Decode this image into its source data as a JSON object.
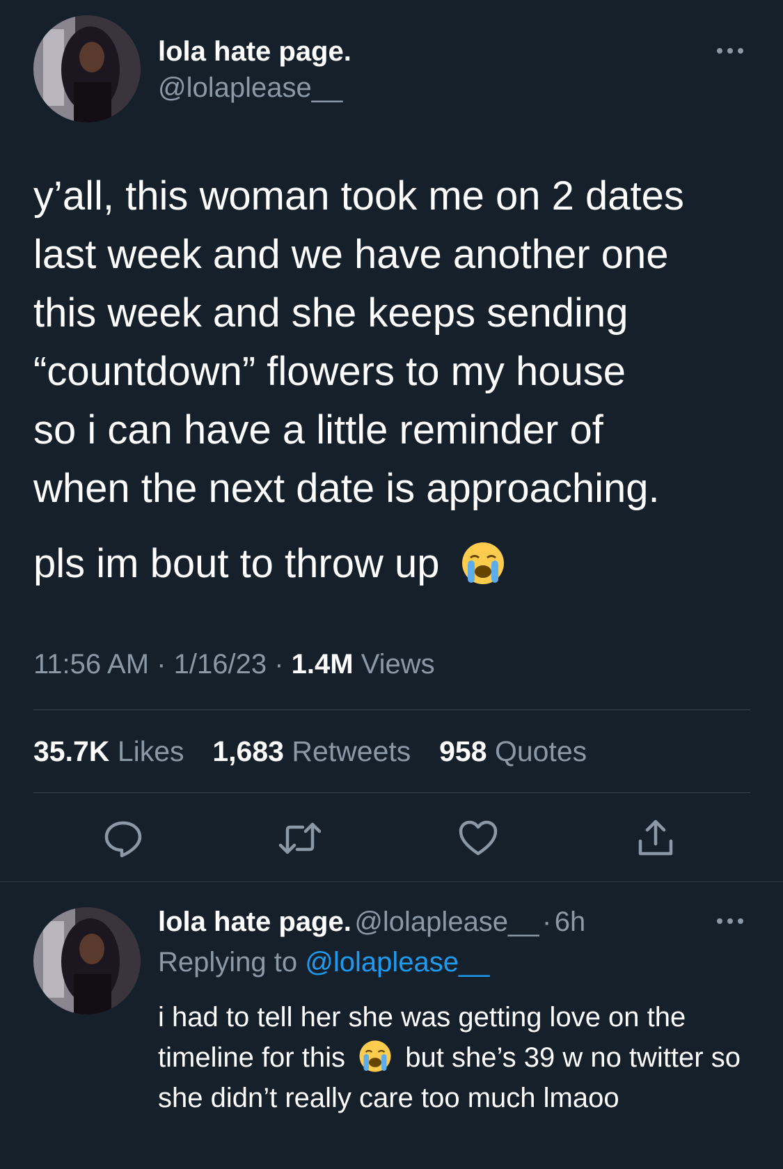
{
  "tweet": {
    "display_name": "lola hate page.",
    "handle": "@lolaplease__",
    "text_lines": [
      "y’all, this woman took me on 2 dates",
      "last week and we have another one",
      "this week and she keeps sending",
      "“countdown” flowers to my house",
      "so i can have a little reminder of",
      "when the next date is approaching."
    ],
    "text_second": "pls im bout to throw up",
    "emoji": "loudly-crying-face",
    "time": "11:56 AM",
    "date": "1/16/23",
    "views_count": "1.4M",
    "views_label": "Views",
    "likes_count": "35.7K",
    "likes_label": "Likes",
    "retweets_count": "1,683",
    "retweets_label": "Retweets",
    "quotes_count": "958",
    "quotes_label": "Quotes",
    "actions": [
      "reply-icon",
      "retweet-icon",
      "like-icon",
      "share-icon"
    ]
  },
  "reply": {
    "display_name": "lola hate page.",
    "handle": "@lolaplease__",
    "age": "6h",
    "replying_prefix": "Replying to",
    "replying_handle": "@lolaplease__",
    "text_part1": "i had to tell her she was getting love on the timeline for this",
    "emoji": "loudly-crying-face",
    "text_part2": "but she’s 39 w no twitter so she didn’t really care too much lmaoo"
  },
  "colors": {
    "background": "#15202b",
    "secondary_text": "#8b98a5",
    "link": "#1d9bf0",
    "divider": "#38444d"
  }
}
